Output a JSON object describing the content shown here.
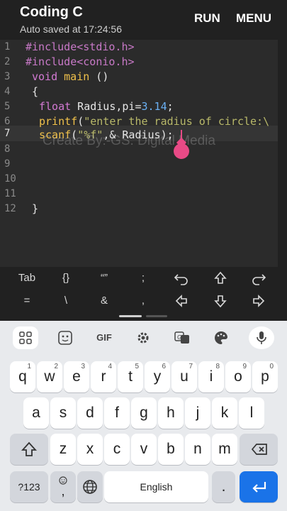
{
  "header": {
    "title": "Coding C",
    "subtitle": "Auto saved at 17:24:56",
    "run_label": "RUN",
    "menu_label": "MENU"
  },
  "editor": {
    "line_numbers": [
      "1",
      "2",
      "3",
      "4",
      "5",
      "6",
      "7",
      "8",
      "9",
      "10",
      "11",
      "12"
    ],
    "active_line": "7",
    "watermark": "Create By:-GS. Digital Media",
    "lines": {
      "l1_pre": "#include",
      "l1_inc": "<stdio.h>",
      "l2_pre": "#include",
      "l2_inc": "<conio.h>",
      "l3_type": "void",
      "l3_fn": "main",
      "l3_rest": " ()",
      "l4": "{",
      "l5_type": "float",
      "l5_rest": " Radius,pi=",
      "l5_num": "3.14",
      "l5_end": ";",
      "l6_fn": "printf",
      "l6_paren": "(",
      "l6_str": "\"enter the radius of circle:\\",
      "l7_fn": "scanf",
      "l7_paren": "(",
      "l7_str": "\"%f\"",
      "l7_rest": ",& Radius);",
      "l12": "}"
    }
  },
  "symbols": {
    "row1": [
      "Tab",
      "{}",
      "“”",
      ";",
      "undo-icon",
      "shift-up-icon",
      "redo-icon"
    ],
    "row2": [
      "=",
      "\\",
      "&",
      ",",
      "arrow-left-icon",
      "arrow-down-icon",
      "arrow-right-icon"
    ],
    "tab": "Tab",
    "braces": "{}",
    "quotes": "“”",
    "semicolon": ";",
    "equals": "=",
    "backslash": "\\",
    "ampersand": "&",
    "comma": ","
  },
  "keyboard": {
    "row1": [
      {
        "k": "q",
        "h": "1"
      },
      {
        "k": "w",
        "h": "2"
      },
      {
        "k": "e",
        "h": "3"
      },
      {
        "k": "r",
        "h": "4"
      },
      {
        "k": "t",
        "h": "5"
      },
      {
        "k": "y",
        "h": "6"
      },
      {
        "k": "u",
        "h": "7"
      },
      {
        "k": "i",
        "h": "8"
      },
      {
        "k": "o",
        "h": "9"
      },
      {
        "k": "p",
        "h": "0"
      }
    ],
    "row2": [
      "a",
      "s",
      "d",
      "f",
      "g",
      "h",
      "j",
      "k",
      "l"
    ],
    "row3": [
      "z",
      "x",
      "c",
      "v",
      "b",
      "n",
      "m"
    ],
    "numbers_label": "?123",
    "space_label": "English",
    "period": ".",
    "comma": ",",
    "gif_label": "GIF",
    "accent": "#1a73e8"
  }
}
